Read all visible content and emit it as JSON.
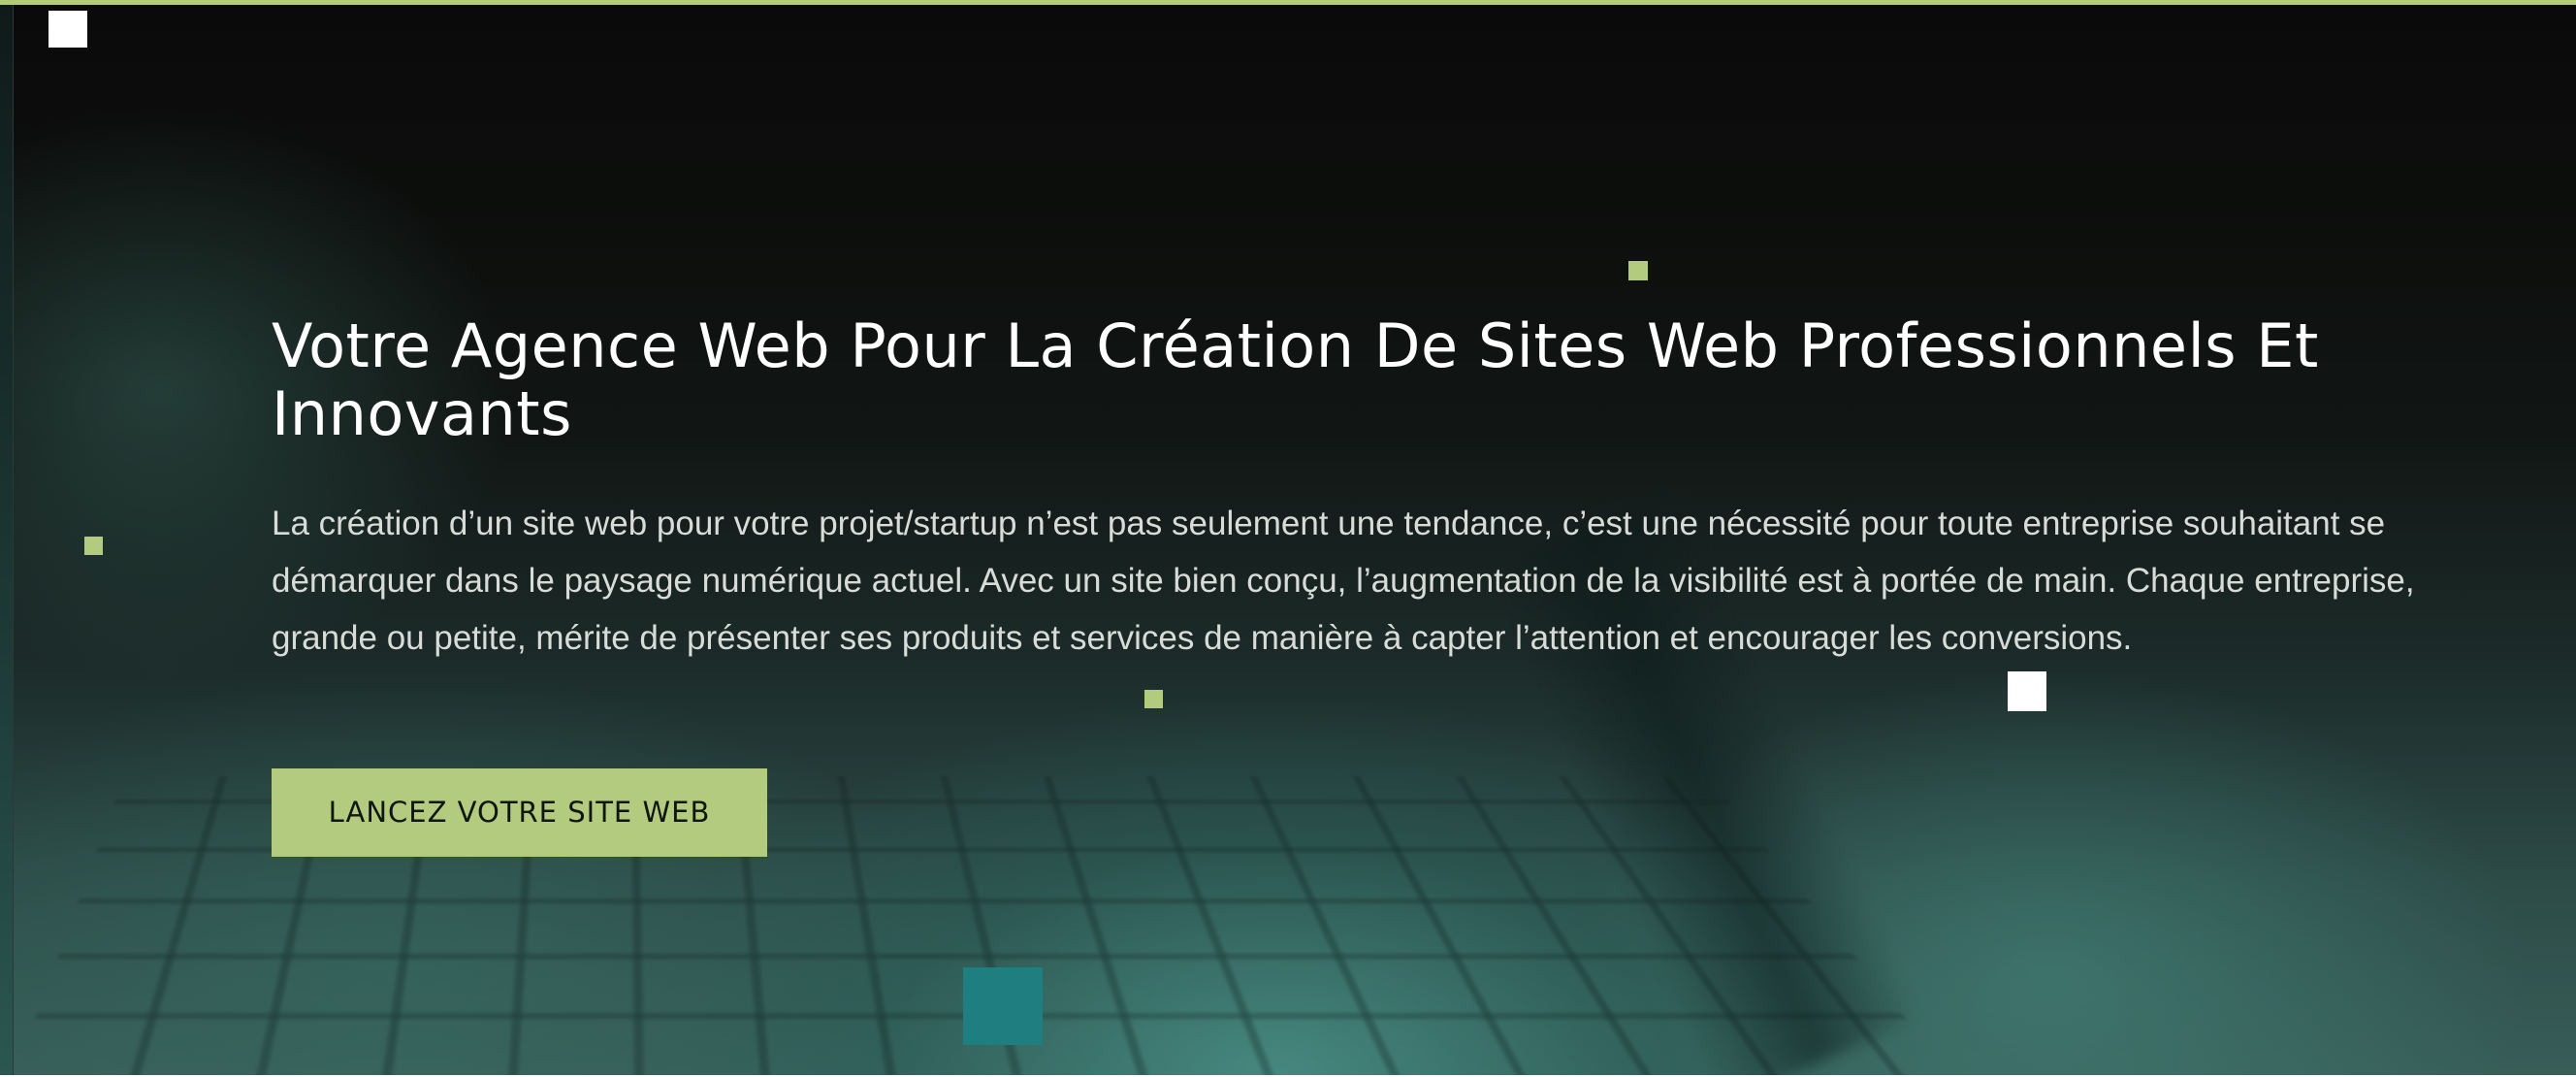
{
  "hero": {
    "title": "Votre Agence Web Pour La Création De Sites Web Professionnels Et Innovants",
    "description": "La création d’un site web pour votre projet/startup n’est pas seulement une tendance, c’est une nécessité pour toute entreprise souhaitant se démarquer dans le paysage numérique actuel. Avec un site bien conçu, l’augmentation de la visibilité est à portée de main. Chaque entreprise, grande ou petite, mérite de présenter ses produits et services de manière à capter l’attention et encourager les conversions.",
    "cta_label": "LANCEZ VOTRE SITE WEB"
  },
  "colors": {
    "accent": "#b2cb7e",
    "background": "#0b0c0b",
    "teal": "#1f7f80",
    "title_text": "#ffffff",
    "body_text": "#d9dcd6"
  }
}
